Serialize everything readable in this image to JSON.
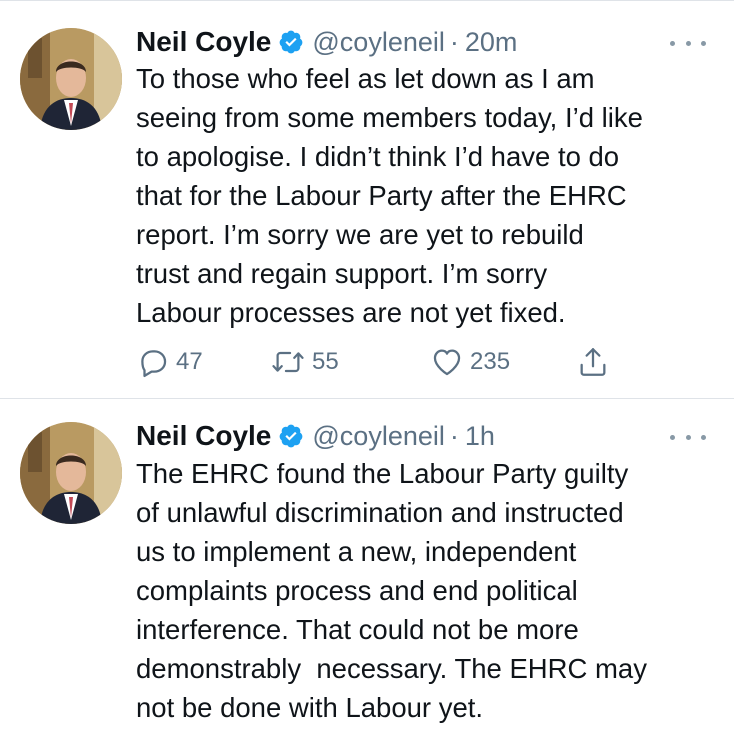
{
  "tweets": [
    {
      "name": "Neil Coyle",
      "handle": "@coyleneil",
      "separator": "·",
      "time": "20m",
      "text": "To those who feel as let down as I am seeing from some members today, I’d like to apologise. I didn’t think I’d have to do that for the Labour Party after the EHRC report. I’m sorry we are yet to rebuild trust and regain support. I’m sorry Labour processes are not yet fixed.",
      "lines": [
        "To those who feel as let down as I am",
        "seeing from some members today, I’d like",
        "to apologise. I didn’t think I’d have to do",
        "that for the Labour Party after the EHRC",
        "report. I’m sorry we are yet to rebuild",
        "trust and regain support. I’m sorry",
        "Labour processes are not yet fixed."
      ],
      "replies": "47",
      "retweets": "55",
      "likes": "235"
    },
    {
      "name": "Neil Coyle",
      "handle": "@coyleneil",
      "separator": "·",
      "time": "1h",
      "lines": [
        "The EHRC found the Labour Party guilty",
        "of unlawful discrimination and instructed",
        "us to implement a new, independent",
        "complaints process and end political",
        "interference. That could not be more",
        "demonstrably  necessary. The EHRC may",
        "not be done with Labour yet."
      ]
    }
  ],
  "icons": {
    "verified": "verified-badge-icon",
    "more": "more-options-icon",
    "reply": "reply-icon",
    "retweet": "retweet-icon",
    "like": "heart-icon",
    "share": "share-icon"
  },
  "colors": {
    "verified": "#1da1f2",
    "secondary_text": "#5b7083",
    "divider": "#dfe3e8"
  }
}
